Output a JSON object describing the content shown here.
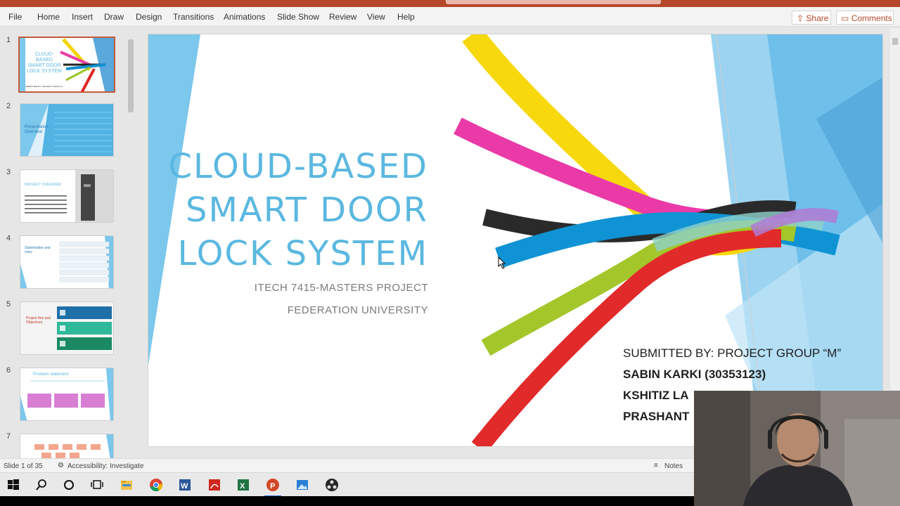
{
  "ribbon": {
    "tabs": [
      "File",
      "Home",
      "Insert",
      "Draw",
      "Design",
      "Transitions",
      "Animations",
      "Slide Show",
      "Review",
      "View",
      "Help"
    ],
    "share_label": "Share",
    "comments_label": "Comments"
  },
  "thumbnails": {
    "numbers": [
      "1",
      "2",
      "3",
      "4",
      "5",
      "6",
      "7"
    ],
    "slide1_title": "CLOUD-BASED SMART DOOR LOCK SYSTEM",
    "slide2_title": "Presentation Overview",
    "slide3_title": "PROJECT OVERVIEW",
    "slide4_title": "Stakeholder and roles",
    "slide5_title": "Project Aim and Objectives",
    "slide6_title": "Problem statement"
  },
  "slide": {
    "title_lines": [
      "CLOUD-BASED",
      "SMART DOOR",
      "LOCK SYSTEM"
    ],
    "subtitle_lines": [
      "ITECH 7415-MASTERS PROJECT",
      "FEDERATION UNIVERSITY"
    ],
    "credits": [
      "SUBMITTED BY: PROJECT GROUP “M”",
      "SABIN KARKI (30353123)",
      "KSHITIZ LA",
      "PRASHANT"
    ]
  },
  "status": {
    "slide_counter": "Slide 1 of 35",
    "accessibility": "Accessibility: Investigate",
    "notes": "Notes"
  },
  "taskbar": {
    "icons": [
      "windows-start-icon",
      "search-icon",
      "cortana-icon",
      "task-view-icon",
      "file-explorer-icon",
      "chrome-icon",
      "word-icon",
      "acrobat-icon",
      "excel-icon",
      "powerpoint-icon",
      "photos-icon",
      "obs-icon"
    ]
  },
  "colors": {
    "accent": "#b7472a",
    "title_blue": "#5bb8e0",
    "panel_blue": "#7cc7ec"
  }
}
